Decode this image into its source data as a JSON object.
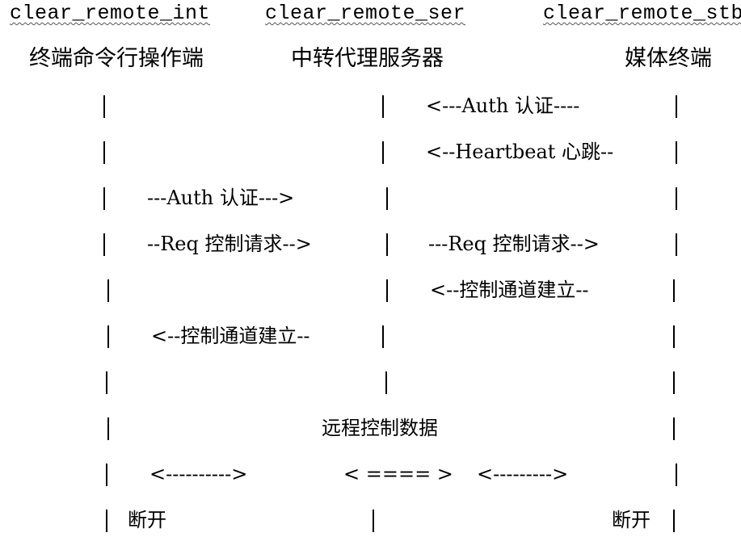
{
  "participants": [
    {
      "id": "clear_remote_int",
      "role": "终端命令行操作端"
    },
    {
      "id": "clear_remote_ser",
      "role": "中转代理服务器"
    },
    {
      "id": "clear_remote_stb",
      "role": "媒体终端"
    }
  ],
  "messages": {
    "stb_auth": "<---Auth 认证----",
    "stb_heartbeat": "<--Heartbeat 心跳--",
    "int_auth": "---Auth 认证--->",
    "int_req": "--Req 控制请求-->",
    "ser_req": "---Req 控制请求-->",
    "stb_channel": "<--控制通道建立--",
    "int_channel": "<--控制通道建立--",
    "remote_data_label": "远程控制数据",
    "data_left": "<---------->",
    "data_mid": "< ==== >",
    "data_right": "<--------->",
    "disconnect_left": "断开",
    "disconnect_right": "断开"
  }
}
